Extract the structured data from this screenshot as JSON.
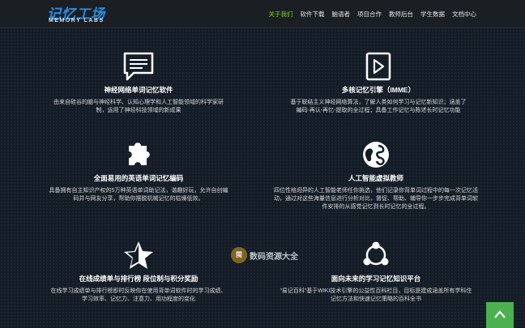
{
  "header": {
    "logo_main": "记忆工场",
    "logo_sub": "MEMORY LABS",
    "nav": [
      {
        "label": "关于我们",
        "active": true
      },
      {
        "label": "软件下载",
        "active": false
      },
      {
        "label": "脑语者",
        "active": false
      },
      {
        "label": "项目合作",
        "active": false
      },
      {
        "label": "教师后台",
        "active": false
      },
      {
        "label": "学生数据",
        "active": false
      },
      {
        "label": "文档中心",
        "active": false
      }
    ]
  },
  "features": [
    {
      "icon": "chat-bubble-icon",
      "title": "神经网络单词记忆软件",
      "desc": "由来自硅谷的脑与神经科学、认知心理学和人工智能领域的科学家研制，运用了神经科技领域的新成果"
    },
    {
      "icon": "play-icon",
      "title": "多核记忆引擎（IMME）",
      "desc": "基于联结主义神经网络算法，了解人类如何学习与记忆新知识；涵盖了编码-再认-再忆-提取的全过程；具备工作记忆与陈述长时记忆功能"
    },
    {
      "icon": "puzzle-icon",
      "title": "全面易用的英语单词记忆编码",
      "desc": "具备拥有自主知识产权的5万种英语单词助记法，谐趣好玩，允许自创编码并与网友分享，帮助你摆脱机械记忆的枯燥低效。"
    },
    {
      "icon": "globe-icon",
      "title": "人工智能虚拟教师",
      "desc": "四位性格迥异的人工智能老师任你挑选，他们记录你背单词过程中的每一次记忆活动，通过对这些海量信息进行分析对比，督促、帮助、辅导你一步步完成背单词软件安排的从感觉记忆到长时记忆的全过程。"
    },
    {
      "icon": "star-icon",
      "title": "在线成绩单与排行榜 段位制与积分奖励",
      "desc": "在线学习成绩单与排行榜即时反映你在使用背单词软件时的学习成绩、学习效率、记忆力、注意力、用功程度的变化"
    },
    {
      "icon": "share-icon",
      "title": "面向未来的学习记忆知识平台",
      "desc": "“易记百科”基于WIKI技术引擎的公益性百科栏目，目标是建成涵盖所有学科住记忆方法和快速记忆策略的百科全书"
    }
  ],
  "watermark": {
    "seal": "閩",
    "text": "数码资源大全"
  },
  "colors": {
    "accent": "#7ed321",
    "brand": "#2a8de0",
    "scroll_button": "#4caf50",
    "background": "#141c26"
  }
}
